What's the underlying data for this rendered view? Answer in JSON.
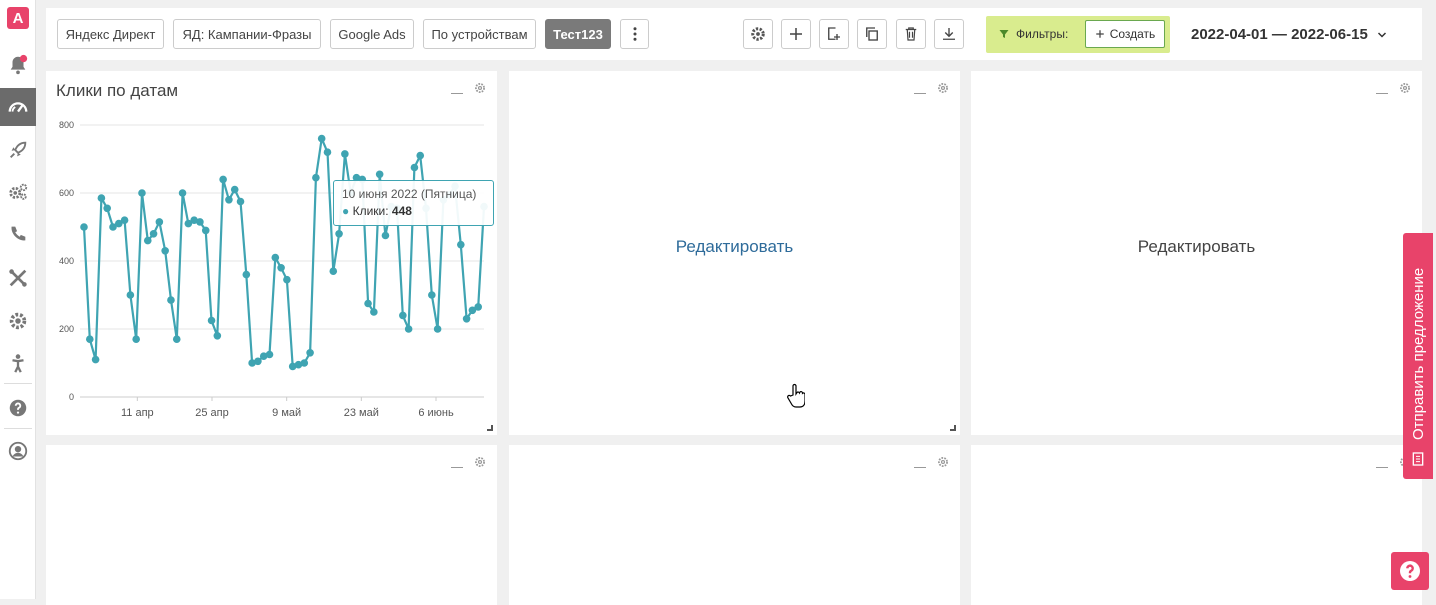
{
  "sidebar": {
    "logo_letter": "A",
    "items": [
      "bell-icon",
      "speedometer-icon",
      "rocket-icon",
      "gears-icon",
      "phone-icon",
      "tools-icon",
      "gear-icon",
      "person-icon",
      "help-icon",
      "user-icon"
    ]
  },
  "toolbar": {
    "tabs": [
      "Яндекс Директ",
      "ЯД: Кампании-Фразы",
      "Google Ads",
      "По устройствам",
      "Тест123"
    ],
    "active_tab": "Тест123",
    "filters_label": "Фильтры:",
    "create_label": "Создать",
    "date_range": "2022-04-01 — 2022-06-15"
  },
  "panels": {
    "chart_title": "Клики по датам",
    "edit_label_1": "Редактировать",
    "edit_label_2": "Редактировать"
  },
  "tooltip": {
    "date": "10 июня 2022 (Пятница)",
    "series": "Клики",
    "value": "448"
  },
  "feedback": {
    "label": "Отправить предложение"
  },
  "colors": {
    "accent": "#e8436a",
    "series": "#3fa4b2",
    "filter_bg": "#d9ec8e",
    "active_tab": "#7a7a7a"
  },
  "chart_data": {
    "type": "line",
    "title": "Клики по датам",
    "xlabel": "",
    "ylabel": "",
    "ylim": [
      0,
      800
    ],
    "yticks": [
      "0",
      "200",
      "400",
      "600",
      "800"
    ],
    "xticks": [
      "11 апр",
      "25 апр",
      "9 май",
      "23 май",
      "6 июнь"
    ],
    "x_start": "2022-04-01",
    "x_end": "2022-06-15",
    "series": [
      {
        "name": "Клики",
        "values": [
          500,
          170,
          110,
          585,
          555,
          500,
          510,
          520,
          300,
          170,
          600,
          460,
          480,
          515,
          430,
          285,
          170,
          600,
          510,
          520,
          515,
          490,
          225,
          180,
          640,
          580,
          610,
          575,
          360,
          100,
          105,
          120,
          125,
          410,
          380,
          345,
          90,
          95,
          100,
          130,
          645,
          760,
          720,
          370,
          480,
          715,
          600,
          645,
          640,
          275,
          250,
          655,
          475,
          560,
          555,
          240,
          200,
          675,
          710,
          555,
          300,
          200,
          580,
          595,
          620,
          448,
          230,
          255,
          265,
          560
        ]
      }
    ],
    "grid": true,
    "legend": "none"
  }
}
